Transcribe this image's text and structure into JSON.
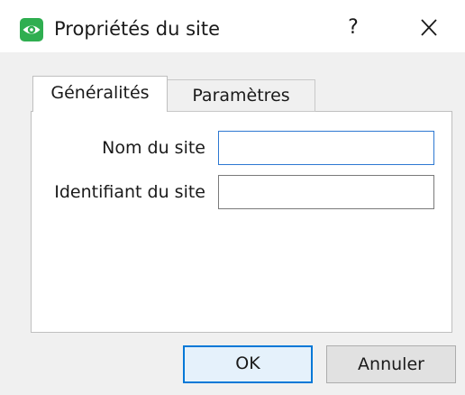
{
  "window": {
    "title": "Propriétés du site",
    "help_label": "?",
    "icons": {
      "app": "eye-icon",
      "close": "close-icon"
    },
    "colors": {
      "app_icon_green": "#2fae50",
      "focus_blue": "#0078d7",
      "client_background": "#f0f0f0"
    }
  },
  "tabs": [
    {
      "label": "Généralités",
      "selected": true
    },
    {
      "label": "Paramètres",
      "selected": false
    }
  ],
  "form": {
    "site_name": {
      "label": "Nom du site",
      "value": "",
      "placeholder": ""
    },
    "site_id": {
      "label": "Identifiant du site",
      "value": "",
      "placeholder": ""
    }
  },
  "buttons": {
    "ok_label": "OK",
    "cancel_label": "Annuler"
  }
}
